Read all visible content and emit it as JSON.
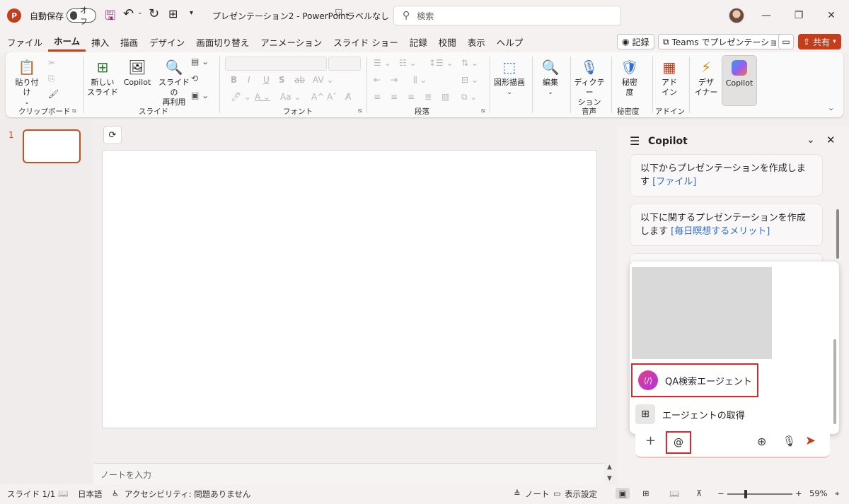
{
  "titlebar": {
    "autosave_label": "自動保存",
    "autosave_state": "オフ",
    "document_title": "プレゼンテーション2 - PowerPoint",
    "sensitivity": "ラベルなし",
    "search_placeholder": "検索",
    "accent": "#c43e1c"
  },
  "menu": {
    "tabs": [
      "ファイル",
      "ホーム",
      "挿入",
      "描画",
      "デザイン",
      "画面切り替え",
      "アニメーション",
      "スライド ショー",
      "記録",
      "校閲",
      "表示",
      "ヘルプ"
    ],
    "active_tab": "ホーム",
    "record_label": "記録",
    "teams_label": "Teams でプレゼンテーション",
    "share_label": "共有"
  },
  "ribbon": {
    "clipboard": {
      "paste": "貼り付け",
      "group": "クリップボード"
    },
    "slides": {
      "new_slide_1": "新しい",
      "new_slide_2": "スライド",
      "copilot": "Copilot",
      "reuse_1": "スライドの",
      "reuse_2": "再利用",
      "group": "スライド"
    },
    "font": {
      "bold": "B",
      "italic": "I",
      "underline": "U",
      "strike": "S",
      "group": "フォント"
    },
    "paragraph": {
      "group": "段落"
    },
    "drawing": {
      "label": "図形描画"
    },
    "editing": {
      "label": "編集"
    },
    "voice": {
      "dictate_1": "ディクテー",
      "dictate_2": "ション",
      "group": "音声"
    },
    "sensitivity": {
      "label_1": "秘密",
      "label_2": "度",
      "group": "秘密度"
    },
    "addins": {
      "label_1": "アド",
      "label_2": "イン",
      "group": "アドイン"
    },
    "designer": {
      "label_1": "デザ",
      "label_2": "イナー"
    },
    "copilot": {
      "label": "Copilot"
    }
  },
  "slides_pane": {
    "slide_number": "1"
  },
  "notes": {
    "placeholder": "ノートを入力"
  },
  "copilot_pane": {
    "title": "Copilot",
    "prompt1_text": "以下からプレゼンテーションを作成します",
    "prompt1_link": "[ファイル]",
    "prompt2_text": "以下に関するプレゼンテーションを作成します",
    "prompt2_link": "[毎日瞑想するメリット]",
    "agent_name": "QA検索エージェント",
    "get_agents": "エージェントの取得",
    "input_value": "@"
  },
  "statusbar": {
    "slide_info": "スライド 1/1",
    "language": "日本語",
    "accessibility": "アクセシビリティ: 問題ありません",
    "notes": "ノート",
    "display_settings": "表示設定",
    "zoom": "59%"
  }
}
